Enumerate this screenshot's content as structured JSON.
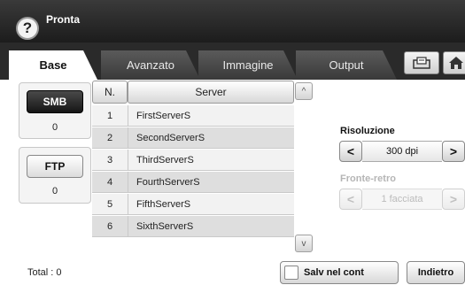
{
  "header": {
    "title": "Pronta",
    "help_symbol": "?"
  },
  "tabs": [
    {
      "label": "Base",
      "active": true
    },
    {
      "label": "Avanzato",
      "active": false
    },
    {
      "label": "Immagine",
      "active": false
    },
    {
      "label": "Output",
      "active": false
    }
  ],
  "toolbar_icons": [
    "tray-icon",
    "home-icon"
  ],
  "protocols": [
    {
      "label": "SMB",
      "count": "0",
      "selected": true
    },
    {
      "label": "FTP",
      "count": "0",
      "selected": false
    }
  ],
  "table": {
    "columns": [
      "N.",
      "Server"
    ],
    "rows": [
      {
        "n": "1",
        "server": "FirstServerS"
      },
      {
        "n": "2",
        "server": "SecondServerS"
      },
      {
        "n": "3",
        "server": "ThirdServerS"
      },
      {
        "n": "4",
        "server": "FourthServerS"
      },
      {
        "n": "5",
        "server": "FifthServerS"
      },
      {
        "n": "6",
        "server": "SixthServerS"
      }
    ],
    "scroll_up": "^",
    "scroll_down": "v"
  },
  "settings": {
    "resolution_label": "Risoluzione",
    "resolution_value": "300 dpi",
    "duplex_label": "Fronte-retro",
    "duplex_value": "1 facciata",
    "prev_symbol": "<",
    "next_symbol": ">"
  },
  "footer": {
    "total": "Total : 0",
    "save_label": "Salv nel cont",
    "back_label": "Indietro"
  }
}
